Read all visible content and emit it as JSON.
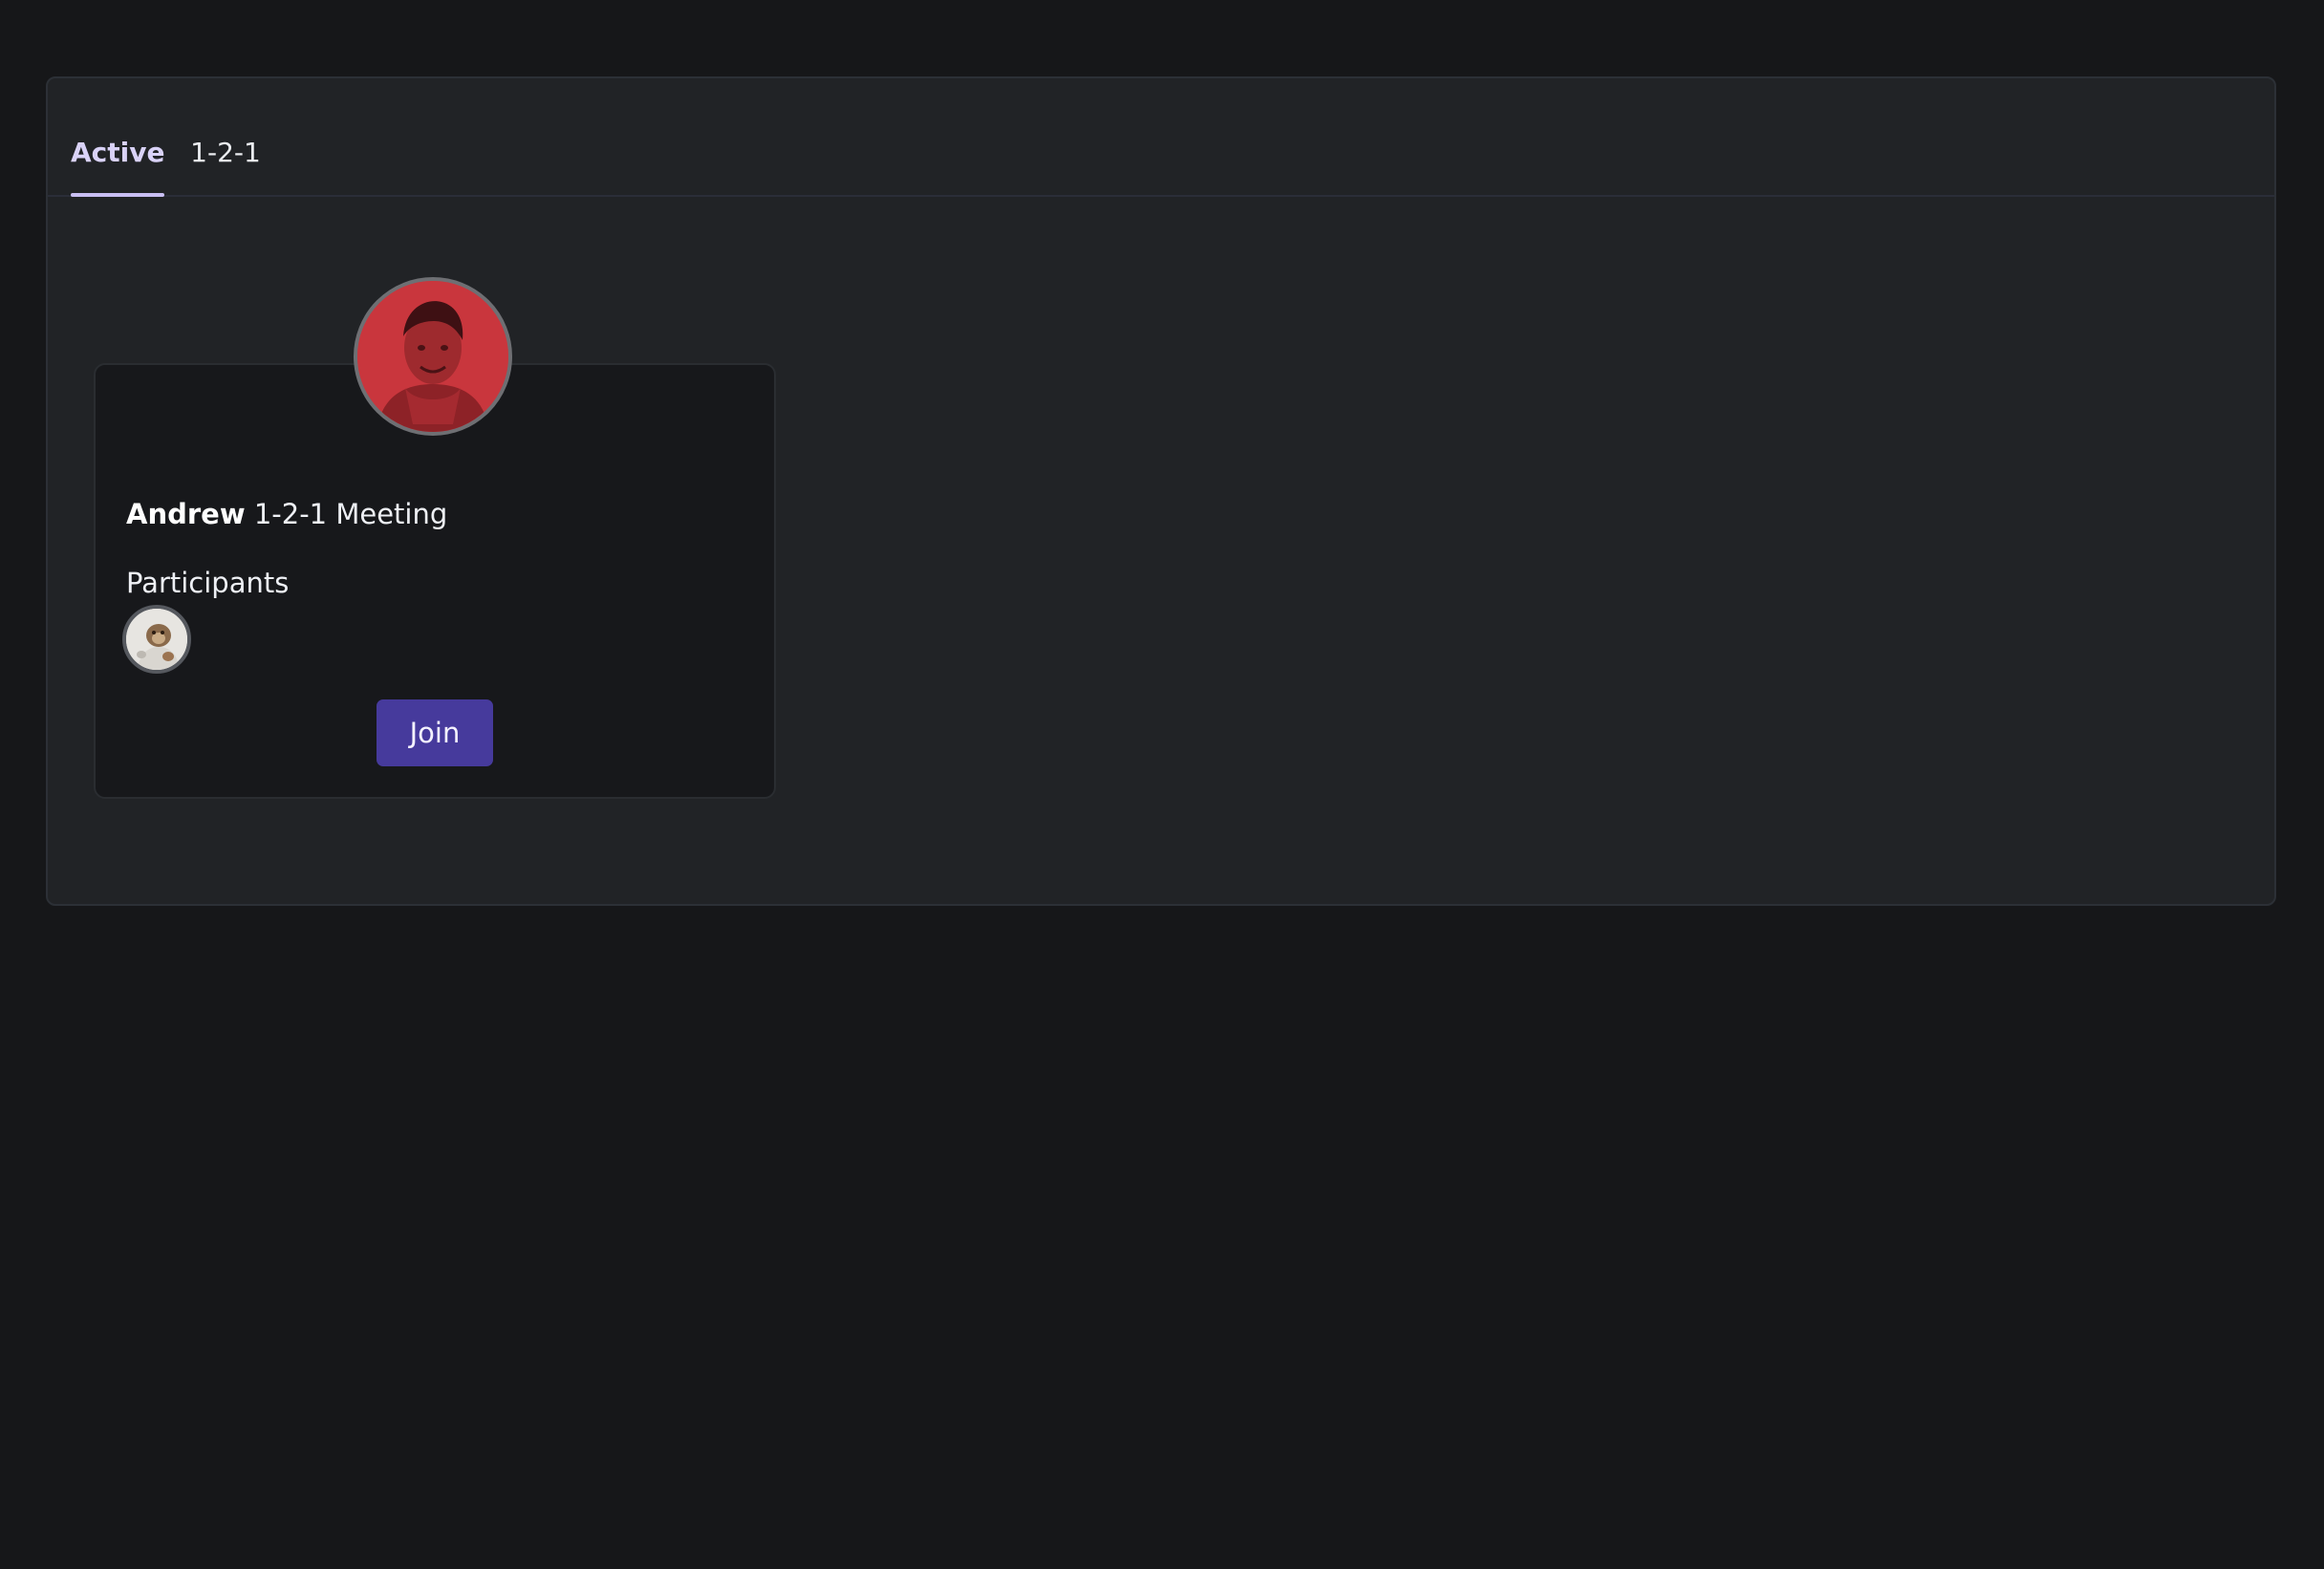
{
  "tabs": [
    {
      "label": "Active"
    },
    {
      "label": "1-2-1"
    }
  ],
  "meeting_card": {
    "host_name": "Andrew",
    "title_suffix": "1-2-1 Meeting",
    "participants_label": "Participants",
    "join_label": "Join"
  },
  "colors": {
    "background": "#161719",
    "panel": "#212326",
    "card": "#17181b",
    "accent_tab": "#c9bff3",
    "join_button": "#463a9c",
    "host_avatar_tint": "#c9363d"
  },
  "icons": {
    "host_avatar": "person-photo-avatar",
    "participant_avatar": "participant-photo-avatar"
  }
}
